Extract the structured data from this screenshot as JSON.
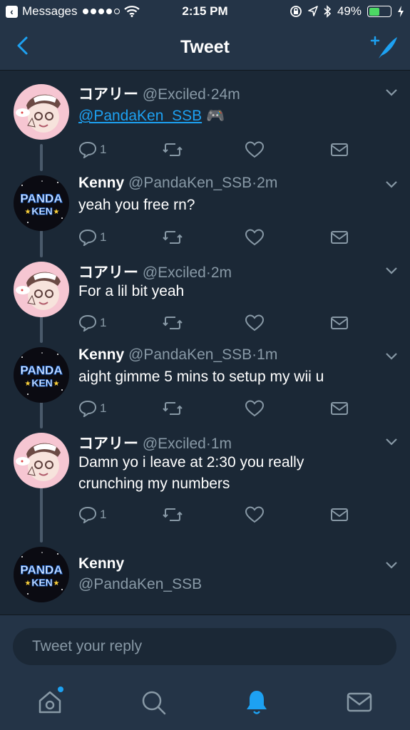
{
  "status_bar": {
    "back_app": "Messages",
    "time": "2:15 PM",
    "battery": "49%",
    "battery_level": 0.49
  },
  "nav": {
    "title": "Tweet"
  },
  "tweets": [
    {
      "name": "コアリー",
      "handle": "@Exciled",
      "sep": "·",
      "time": "24m",
      "mention": "@PandaKen_SSB",
      "emoji": "🎮",
      "replies": "1"
    },
    {
      "name": "Kenny",
      "handle": "@PandaKen_SSB",
      "sep": "·",
      "time": "2m",
      "text": "yeah you free rn?",
      "replies": "1"
    },
    {
      "name": "コアリー",
      "handle": "@Exciled",
      "sep": "·",
      "time": "2m",
      "text": "For a lil bit yeah",
      "replies": "1"
    },
    {
      "name": "Kenny",
      "handle": "@PandaKen_SSB",
      "sep": "·",
      "time": "1m",
      "text": "aight gimme 5 mins to setup my wii u",
      "replies": "1"
    },
    {
      "name": "コアリー",
      "handle": "@Exciled",
      "sep": "·",
      "time": "1m",
      "text_line1": "Damn yo i leave at 2:30 you really",
      "text_line2": "crunching my numbers",
      "replies": "1"
    }
  ],
  "compose_author": {
    "name": "Kenny",
    "handle": "@PandaKen_SSB"
  },
  "avatars": {
    "panda_line1": "PANDA",
    "panda_line2": "KEN"
  },
  "reply": {
    "placeholder": "Tweet your reply"
  },
  "colors": {
    "background": "#1b2836",
    "bar": "#243447",
    "accent": "#1da1f2",
    "muted": "#8899a6"
  },
  "tabs": [
    "home-icon",
    "search-icon",
    "notifications-bell-icon",
    "messages-envelope-icon"
  ]
}
